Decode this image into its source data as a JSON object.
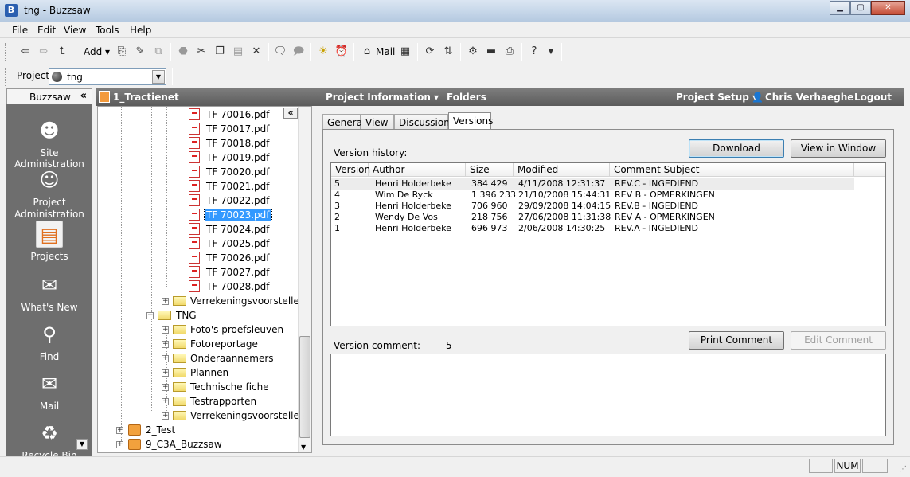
{
  "window": {
    "title": "tng - Buzzsaw",
    "app_icon": "B"
  },
  "menu": [
    "File",
    "Edit",
    "View",
    "Tools",
    "Help"
  ],
  "toolbar": {
    "add_label": "Add ▾",
    "mail_label": "Mail"
  },
  "project_bar": {
    "label": "Project",
    "value": "tng"
  },
  "sidebar": {
    "title": "Buzzsaw",
    "items": [
      {
        "label": "Site Administration"
      },
      {
        "label": "Project Administration"
      },
      {
        "label": "Projects"
      },
      {
        "label": "What's New"
      },
      {
        "label": "Find"
      },
      {
        "label": "Mail"
      },
      {
        "label": "Recycle Bin"
      }
    ]
  },
  "header": {
    "project": "1_Tractienet",
    "project_information": "Project Information ▾",
    "folders": "Folders",
    "project_setup": "Project Setup ▾",
    "user": "Chris Verhaeghe",
    "logout": "Logout"
  },
  "tree": {
    "files": [
      "TF 70016.pdf",
      "TF 70017.pdf",
      "TF 70018.pdf",
      "TF 70019.pdf",
      "TF 70020.pdf",
      "TF 70021.pdf",
      "TF 70022.pdf",
      "TF 70023.pdf",
      "TF 70024.pdf",
      "TF 70025.pdf",
      "TF 70026.pdf",
      "TF 70027.pdf",
      "TF 70028.pdf"
    ],
    "folder_verrekening_1": "Verrekeningsvoorstellen",
    "tng_folder": "TNG",
    "tng_children": [
      "Foto's proefsleuven",
      "Fotoreportage",
      "Onderaannemers",
      "Plannen",
      "Technische fiche",
      "Testrapporten",
      "Verrekeningsvoorstellen"
    ],
    "projects": [
      "2_Test",
      "9_C3A_Buzzsaw"
    ]
  },
  "tabs": [
    "General",
    "View",
    "Discussions",
    "Versions"
  ],
  "versions": {
    "history_label": "Version history:",
    "download": "Download",
    "view_in_window": "View in Window",
    "columns": [
      "Version",
      "Author",
      "Size",
      "Modified",
      "Comment Subject"
    ],
    "rows": [
      {
        "version": "5",
        "author": "Henri Holderbeke",
        "size": "384 429",
        "modified": "4/11/2008  12:31:37",
        "subject": "REV.C - INGEDIEND"
      },
      {
        "version": "4",
        "author": "Wim De Ryck",
        "size": "1 396 233",
        "modified": "21/10/2008  15:44:31",
        "subject": "REV B - OPMERKINGEN"
      },
      {
        "version": "3",
        "author": "Henri Holderbeke",
        "size": "706 960",
        "modified": "29/09/2008  14:04:15",
        "subject": "REV.B - INGEDIEND"
      },
      {
        "version": "2",
        "author": "Wendy De Vos",
        "size": "218 756",
        "modified": "27/06/2008  11:31:38",
        "subject": "REV A - OPMERKINGEN"
      },
      {
        "version": "1",
        "author": "Henri Holderbeke",
        "size": "696 973",
        "modified": "2/06/2008  14:30:25",
        "subject": "REV.A - INGEDIEND"
      }
    ],
    "comment_label": "Version comment:",
    "comment_version": "5",
    "print_comment": "Print Comment",
    "edit_comment": "Edit Comment"
  },
  "status": {
    "num": "NUM"
  }
}
